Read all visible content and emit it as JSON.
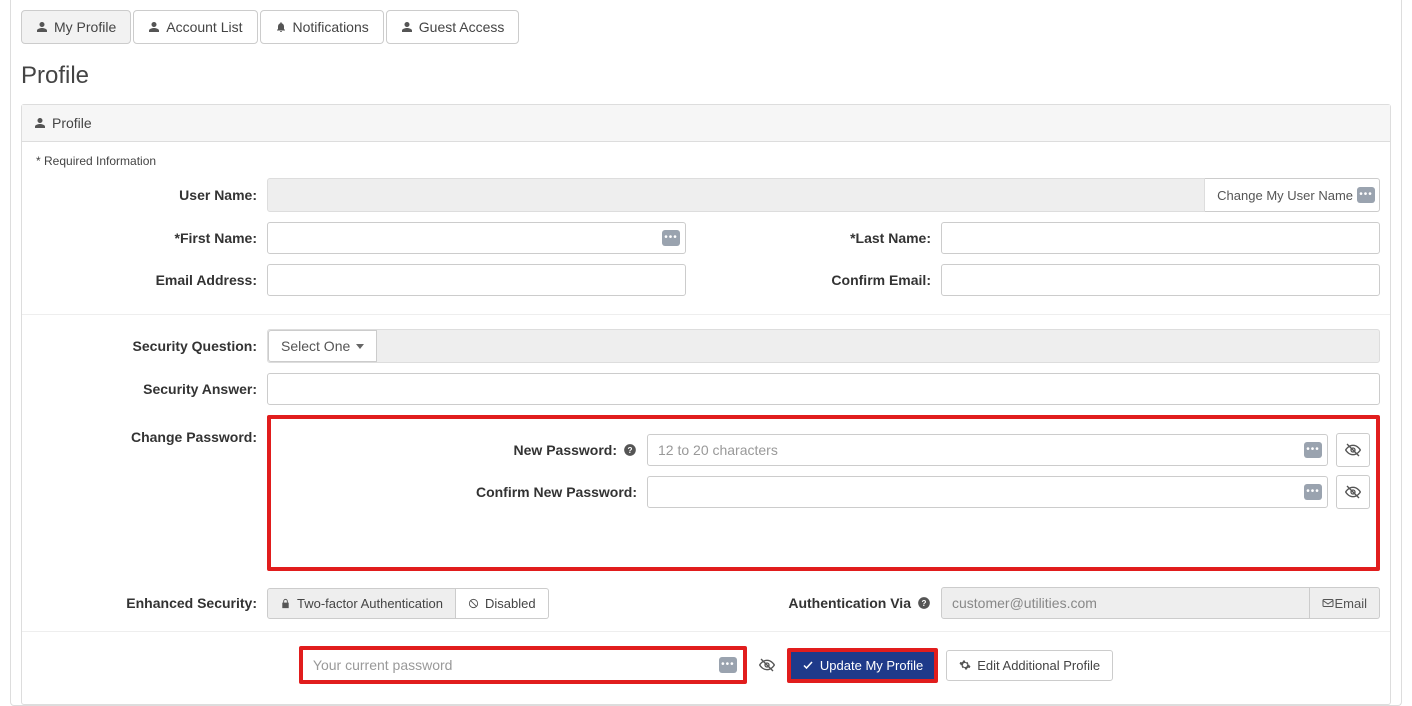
{
  "tabs": {
    "my_profile": "My Profile",
    "account_list": "Account List",
    "notifications": "Notifications",
    "guest_access": "Guest Access"
  },
  "page": {
    "title": "Profile",
    "panel_title": "Profile",
    "required_note": "* Required Information"
  },
  "labels": {
    "user_name": "User Name:",
    "first_name": "*First Name:",
    "last_name": "*Last Name:",
    "email_address": "Email Address:",
    "confirm_email": "Confirm Email:",
    "security_question": "Security Question:",
    "security_answer": "Security Answer:",
    "change_password": "Change Password:",
    "new_password": "New Password:",
    "confirm_new_password": "Confirm New Password:",
    "enhanced_security": "Enhanced Security:",
    "authentication_via": "Authentication Via"
  },
  "inputs": {
    "user_name_value": "",
    "first_name_value": "",
    "last_name_value": "",
    "email_value": "",
    "confirm_email_value": "",
    "security_answer_value": "",
    "new_password_placeholder": "12 to 20 characters",
    "new_password_value": "",
    "confirm_new_password_value": "",
    "current_password_placeholder": "Your current password",
    "current_password_value": "",
    "auth_via_value": "customer@utilities.com"
  },
  "buttons": {
    "change_username": "Change My User Name",
    "select_one": "Select One",
    "two_factor": "Two-factor Authentication",
    "disabled": "Disabled",
    "email_addon": "Email",
    "update_profile": "Update My Profile",
    "edit_additional": "Edit Additional Profile"
  }
}
